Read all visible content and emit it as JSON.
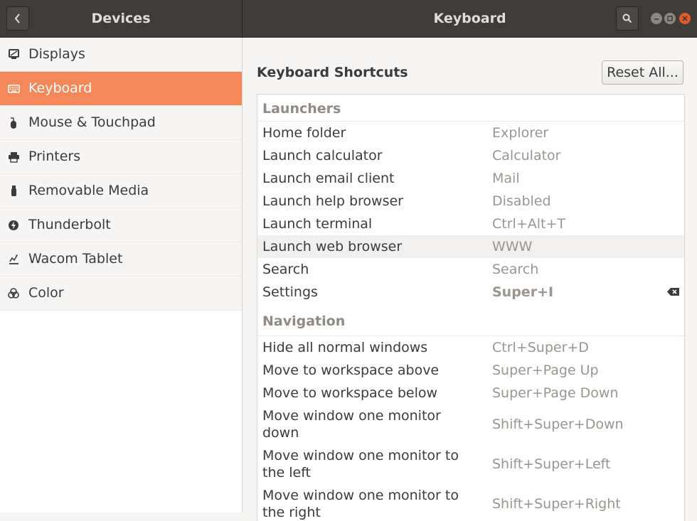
{
  "header": {
    "left_title": "Devices",
    "right_title": "Keyboard"
  },
  "sidebar": {
    "items": [
      {
        "label": "Displays",
        "icon": "display-icon"
      },
      {
        "label": "Keyboard",
        "icon": "keyboard-icon",
        "selected": true
      },
      {
        "label": "Mouse & Touchpad",
        "icon": "mouse-icon"
      },
      {
        "label": "Printers",
        "icon": "printer-icon"
      },
      {
        "label": "Removable Media",
        "icon": "usb-drive-icon"
      },
      {
        "label": "Thunderbolt",
        "icon": "thunderbolt-icon"
      },
      {
        "label": "Wacom Tablet",
        "icon": "tablet-icon"
      },
      {
        "label": "Color",
        "icon": "color-icon"
      }
    ]
  },
  "main": {
    "section_title": "Keyboard Shortcuts",
    "reset_label": "Reset All...",
    "categories": [
      {
        "name": "Launchers",
        "rows": [
          {
            "name": "Home folder",
            "shortcut": "Explorer"
          },
          {
            "name": "Launch calculator",
            "shortcut": "Calculator"
          },
          {
            "name": "Launch email client",
            "shortcut": "Mail"
          },
          {
            "name": "Launch help browser",
            "shortcut": "Disabled"
          },
          {
            "name": "Launch terminal",
            "shortcut": "Ctrl+Alt+T"
          },
          {
            "name": "Launch web browser",
            "shortcut": "WWW"
          },
          {
            "name": "Search",
            "shortcut": "Search"
          },
          {
            "name": "Settings",
            "shortcut": "Super+I"
          }
        ]
      },
      {
        "name": "Navigation",
        "rows": [
          {
            "name": "Hide all normal windows",
            "shortcut": "Ctrl+Super+D"
          },
          {
            "name": "Move to workspace above",
            "shortcut": "Super+Page Up"
          },
          {
            "name": "Move to workspace below",
            "shortcut": "Super+Page Down"
          },
          {
            "name": "Move window one monitor down",
            "shortcut": "Shift+Super+Down"
          },
          {
            "name": "Move window one monitor to the left",
            "shortcut": "Shift+Super+Left"
          },
          {
            "name": "Move window one monitor to the right",
            "shortcut": "Shift+Super+Right"
          }
        ]
      }
    ]
  },
  "colors": {
    "accent": "#f4885a",
    "header_bg": "#3e3c38",
    "close_button": "#e35b2b"
  }
}
